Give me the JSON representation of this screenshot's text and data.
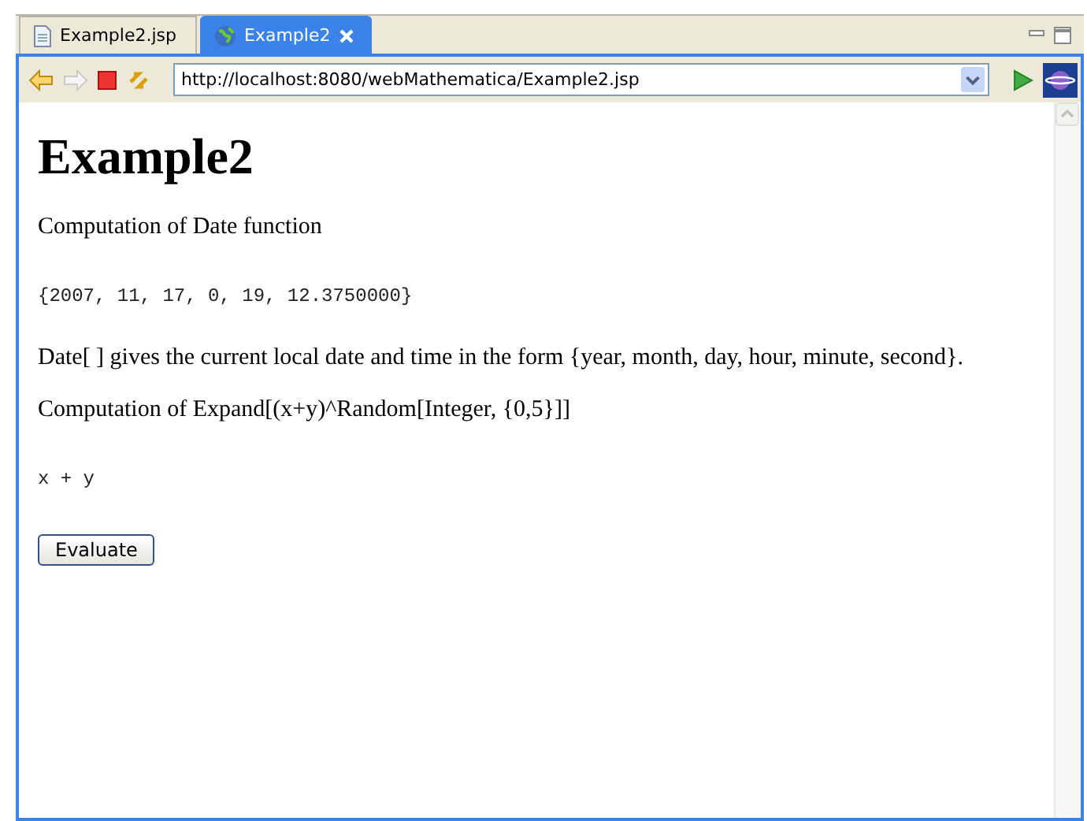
{
  "tabs": [
    {
      "label": "Example2.jsp",
      "kind": "file",
      "selected": false
    },
    {
      "label": "Example2",
      "kind": "web",
      "selected": true
    }
  ],
  "address": {
    "value": "http://localhost:8080/webMathematica/Example2.jsp"
  },
  "page": {
    "heading": "Example2",
    "blocks": [
      {
        "kind": "text",
        "text": "Computation of Date function"
      },
      {
        "kind": "code",
        "text": "{2007, 11, 17, 0, 19, 12.3750000}"
      },
      {
        "kind": "text",
        "text": "Date[ ] gives the current local date and time in the form {year, month, day, hour, minute, second}."
      },
      {
        "kind": "text",
        "text": "Computation of Expand[(x+y)^Random[Integer, {0,5}]]"
      },
      {
        "kind": "code",
        "text": "x + y"
      },
      {
        "kind": "button",
        "text": "Evaluate"
      }
    ]
  }
}
